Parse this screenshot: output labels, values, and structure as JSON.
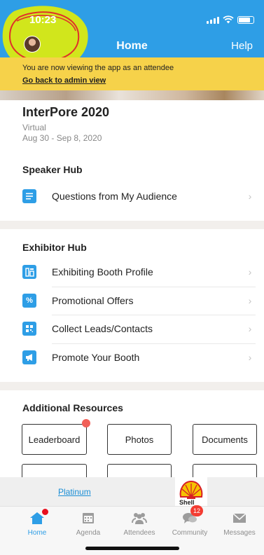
{
  "status": {
    "time": "10:23"
  },
  "nav": {
    "title": "Home",
    "help": "Help"
  },
  "banner": {
    "message": "You are now viewing the app as an attendee",
    "link": "Go back to admin view"
  },
  "event": {
    "title": "InterPore 2020",
    "location": "Virtual",
    "dates": "Aug 30 - Sep 8, 2020"
  },
  "speaker_hub": {
    "heading": "Speaker Hub",
    "items": [
      {
        "label": "Questions from My Audience",
        "icon": "list-icon"
      }
    ]
  },
  "exhibitor_hub": {
    "heading": "Exhibitor Hub",
    "items": [
      {
        "label": "Exhibiting Booth Profile",
        "icon": "booth-icon"
      },
      {
        "label": "Promotional Offers",
        "icon": "percent-badge-icon"
      },
      {
        "label": "Collect Leads/Contacts",
        "icon": "qr-code-icon"
      },
      {
        "label": "Promote Your Booth",
        "icon": "megaphone-icon"
      }
    ]
  },
  "resources": {
    "heading": "Additional Resources",
    "buttons": [
      "Leaderboard",
      "Photos",
      "Documents"
    ]
  },
  "sponsor": {
    "tier": "Platinum",
    "logo_text": "Shell"
  },
  "tabs": [
    {
      "label": "Home",
      "icon": "home-icon"
    },
    {
      "label": "Agenda",
      "icon": "calendar-icon"
    },
    {
      "label": "Attendees",
      "icon": "people-icon"
    },
    {
      "label": "Community",
      "icon": "chat-bubbles-icon",
      "badge": "12"
    },
    {
      "label": "Messages",
      "icon": "envelope-icon"
    }
  ],
  "colors": {
    "primary": "#2e9ee6",
    "banner": "#f6d24a",
    "notification": "#f33c32",
    "annotation_highlight": "#e8f000",
    "annotation_circle": "#e0302a"
  }
}
